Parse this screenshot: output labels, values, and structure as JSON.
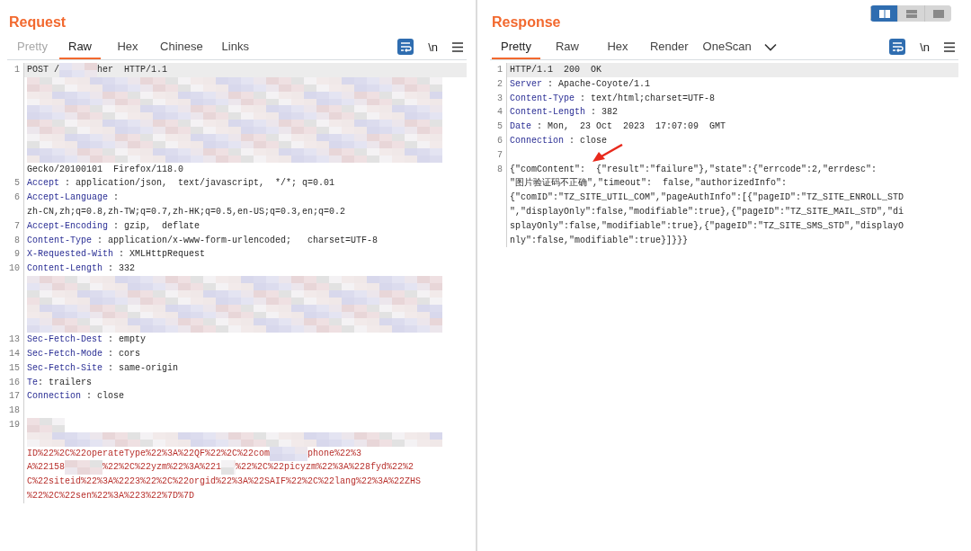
{
  "panes": [
    {
      "title": "Request",
      "tabs": [
        {
          "label": "Pretty",
          "selected": false,
          "disabled": true
        },
        {
          "label": "Raw",
          "selected": true,
          "disabled": false
        },
        {
          "label": "Hex",
          "selected": false,
          "disabled": false
        },
        {
          "label": "Chinese",
          "selected": false,
          "disabled": false
        },
        {
          "label": "Links",
          "selected": false,
          "disabled": false
        }
      ],
      "more_tabs_menu": false,
      "toolbar": {
        "wrap_on": true,
        "newline_label": "\\n"
      },
      "rows": [
        {
          "num": "1",
          "highlighted": true,
          "segments": [
            {
              "kind": "text",
              "text": "POST /"
            },
            {
              "kind": "blur-short"
            },
            {
              "kind": "text",
              "text": "her  HTTP/1.1"
            }
          ]
        },
        {
          "highlighted": false,
          "segments": [
            {
              "kind": "blur-wide"
            }
          ]
        },
        {
          "highlighted": false,
          "segments": [
            {
              "kind": "blur-wide"
            }
          ]
        },
        {
          "highlighted": false,
          "segments": [
            {
              "kind": "blur-wide"
            }
          ]
        },
        {
          "highlighted": false,
          "segments": [
            {
              "kind": "blur-wide"
            }
          ]
        },
        {
          "highlighted": false,
          "segments": [
            {
              "kind": "blur-wide"
            }
          ]
        },
        {
          "highlighted": false,
          "segments": [
            {
              "kind": "blur-wide"
            }
          ]
        },
        {
          "highlighted": false,
          "segments": [
            {
              "kind": "text",
              "text": "Gecko/20100101  Firefox/118.0"
            }
          ]
        },
        {
          "num": "5",
          "highlighted": false,
          "segments": [
            {
              "kind": "name",
              "text": "Accept"
            },
            {
              "kind": "text",
              "text": " : application/json,  text/javascript,  */*; q=0.01"
            }
          ]
        },
        {
          "num": "6",
          "highlighted": false,
          "segments": [
            {
              "kind": "name",
              "text": "Accept-Language"
            },
            {
              "kind": "text",
              "text": " :"
            }
          ]
        },
        {
          "highlighted": false,
          "segments": [
            {
              "kind": "text",
              "text": "zh-CN,zh;q=0.8,zh-TW;q=0.7,zh-HK;q=0.5,en-US;q=0.3,en;q=0.2"
            }
          ]
        },
        {
          "num": "7",
          "highlighted": false,
          "segments": [
            {
              "kind": "name",
              "text": "Accept-Encoding"
            },
            {
              "kind": "text",
              "text": " : gzip,  deflate"
            }
          ]
        },
        {
          "num": "8",
          "highlighted": false,
          "segments": [
            {
              "kind": "name",
              "text": "Content-Type"
            },
            {
              "kind": "text",
              "text": " : application/x-www-form-urlencoded;   charset=UTF-8"
            }
          ]
        },
        {
          "num": "9",
          "highlighted": false,
          "segments": [
            {
              "kind": "name",
              "text": "X-Requested-With"
            },
            {
              "kind": "text",
              "text": " : XMLHttpRequest"
            }
          ]
        },
        {
          "num": "10",
          "highlighted": false,
          "segments": [
            {
              "kind": "name",
              "text": "Content-Length"
            },
            {
              "kind": "text",
              "text": " : 332"
            }
          ]
        },
        {
          "highlighted": false,
          "segments": [
            {
              "kind": "blur-wide"
            }
          ]
        },
        {
          "highlighted": false,
          "segments": [
            {
              "kind": "blur-wide"
            }
          ]
        },
        {
          "highlighted": false,
          "segments": [
            {
              "kind": "blur-wide"
            }
          ]
        },
        {
          "highlighted": false,
          "segments": [
            {
              "kind": "blur-wide"
            }
          ]
        },
        {
          "num": "13",
          "highlighted": false,
          "segments": [
            {
              "kind": "name",
              "text": "Sec-Fetch-Dest"
            },
            {
              "kind": "text",
              "text": " : empty"
            }
          ]
        },
        {
          "num": "14",
          "highlighted": false,
          "segments": [
            {
              "kind": "name",
              "text": "Sec-Fetch-Mode"
            },
            {
              "kind": "text",
              "text": " : cors"
            }
          ]
        },
        {
          "num": "15",
          "highlighted": false,
          "segments": [
            {
              "kind": "name",
              "text": "Sec-Fetch-Site"
            },
            {
              "kind": "text",
              "text": " : same-origin"
            }
          ]
        },
        {
          "num": "16",
          "highlighted": false,
          "segments": [
            {
              "kind": "name",
              "text": "Te"
            },
            {
              "kind": "text",
              "text": ": trailers"
            }
          ]
        },
        {
          "num": "17",
          "highlighted": false,
          "segments": [
            {
              "kind": "name",
              "text": "Connection"
            },
            {
              "kind": "text",
              "text": " : close"
            }
          ]
        },
        {
          "num": "18",
          "highlighted": false,
          "segments": []
        },
        {
          "num": "19",
          "highlighted": false,
          "segments": [
            {
              "kind": "blur-short"
            }
          ]
        },
        {
          "highlighted": false,
          "segments": [
            {
              "kind": "blur-wide"
            }
          ]
        },
        {
          "highlighted": false,
          "segments": [
            {
              "kind": "body",
              "text": "ID%22%2C%22operateType%22%3A%22QF%22%2C%22com"
            },
            {
              "kind": "blur-short"
            },
            {
              "kind": "body",
              "text": "phone%22%3"
            }
          ]
        },
        {
          "highlighted": false,
          "segments": [
            {
              "kind": "body",
              "text": "A%22158"
            },
            {
              "kind": "blur-short"
            },
            {
              "kind": "body",
              "text": "%22%2C%22yzm%22%3A%221"
            },
            {
              "kind": "blur-tiny"
            },
            {
              "kind": "body",
              "text": "%22%2C%22picyzm%22%3A%228fyd%22%2"
            }
          ]
        },
        {
          "highlighted": false,
          "segments": [
            {
              "kind": "body",
              "text": "C%22siteid%22%3A%2223%22%2C%22orgid%22%3A%22SAIF%22%2C%22lang%22%3A%22ZHS"
            }
          ]
        },
        {
          "highlighted": false,
          "segments": [
            {
              "kind": "body",
              "text": "%22%2C%22sen%22%3A%223%22%7D%7D"
            }
          ]
        }
      ]
    },
    {
      "title": "Response",
      "tabs": [
        {
          "label": "Pretty",
          "selected": true,
          "disabled": false
        },
        {
          "label": "Raw",
          "selected": false,
          "disabled": false
        },
        {
          "label": "Hex",
          "selected": false,
          "disabled": false
        },
        {
          "label": "Render",
          "selected": false,
          "disabled": false
        },
        {
          "label": "OneScan",
          "selected": false,
          "disabled": false
        }
      ],
      "more_tabs_menu": true,
      "toolbar": {
        "wrap_on": true,
        "newline_label": "\\n"
      },
      "layout_toggle": [
        {
          "kind": "split",
          "selected": true
        },
        {
          "kind": "stacked",
          "selected": false
        },
        {
          "kind": "single",
          "selected": false
        }
      ],
      "rows": [
        {
          "num": "1",
          "highlighted": true,
          "segments": [
            {
              "kind": "text",
              "text": "HTTP/1.1  200  OK"
            }
          ]
        },
        {
          "num": "2",
          "highlighted": false,
          "segments": [
            {
              "kind": "name",
              "text": "Server"
            },
            {
              "kind": "text",
              "text": " : Apache-Coyote/1.1"
            }
          ]
        },
        {
          "num": "3",
          "highlighted": false,
          "segments": [
            {
              "kind": "name",
              "text": "Content-Type"
            },
            {
              "kind": "text",
              "text": " : text/html;charset=UTF-8"
            }
          ]
        },
        {
          "num": "4",
          "highlighted": false,
          "segments": [
            {
              "kind": "name",
              "text": "Content-Length"
            },
            {
              "kind": "text",
              "text": " : 382"
            }
          ]
        },
        {
          "num": "5",
          "highlighted": false,
          "segments": [
            {
              "kind": "name",
              "text": "Date"
            },
            {
              "kind": "text",
              "text": " : Mon,  23 Oct  2023  17:07:09  GMT"
            }
          ]
        },
        {
          "num": "6",
          "highlighted": false,
          "segments": [
            {
              "kind": "name",
              "text": "Connection"
            },
            {
              "kind": "text",
              "text": " : close"
            }
          ]
        },
        {
          "num": "7",
          "highlighted": false,
          "segments": []
        },
        {
          "num": "8",
          "highlighted": false,
          "segments": [
            {
              "kind": "text",
              "text": "{\"comContent\":  {\"result\":\"failure\"},\"state\":{\"errcode\":2,\"errdesc\":"
            }
          ]
        },
        {
          "highlighted": false,
          "segments": [
            {
              "kind": "text",
              "text": "\"图片验证码不正确\",\"timeout\":  false,\"authorizedInfo\":"
            }
          ]
        },
        {
          "highlighted": false,
          "segments": [
            {
              "kind": "text",
              "text": "{\"comID\":\"TZ_SITE_UTIL_COM\",\"pageAuthInfo\":[{\"pageID\":\"TZ_SITE_ENROLL_STD"
            }
          ]
        },
        {
          "highlighted": false,
          "segments": [
            {
              "kind": "text",
              "text": "\",\"displayOnly\":false,\"modifiable\":true},{\"pageID\":\"TZ_SITE_MAIL_STD\",\"di"
            }
          ]
        },
        {
          "highlighted": false,
          "segments": [
            {
              "kind": "text",
              "text": "splayOnly\":false,\"modifiable\":true},{\"pageID\":\"TZ_SITE_SMS_STD\",\"displayO"
            }
          ]
        },
        {
          "highlighted": false,
          "segments": [
            {
              "kind": "text",
              "text": "nly\":false,\"modifiable\":true}]}}}"
            }
          ]
        }
      ],
      "annotation_arrow": true
    }
  ]
}
